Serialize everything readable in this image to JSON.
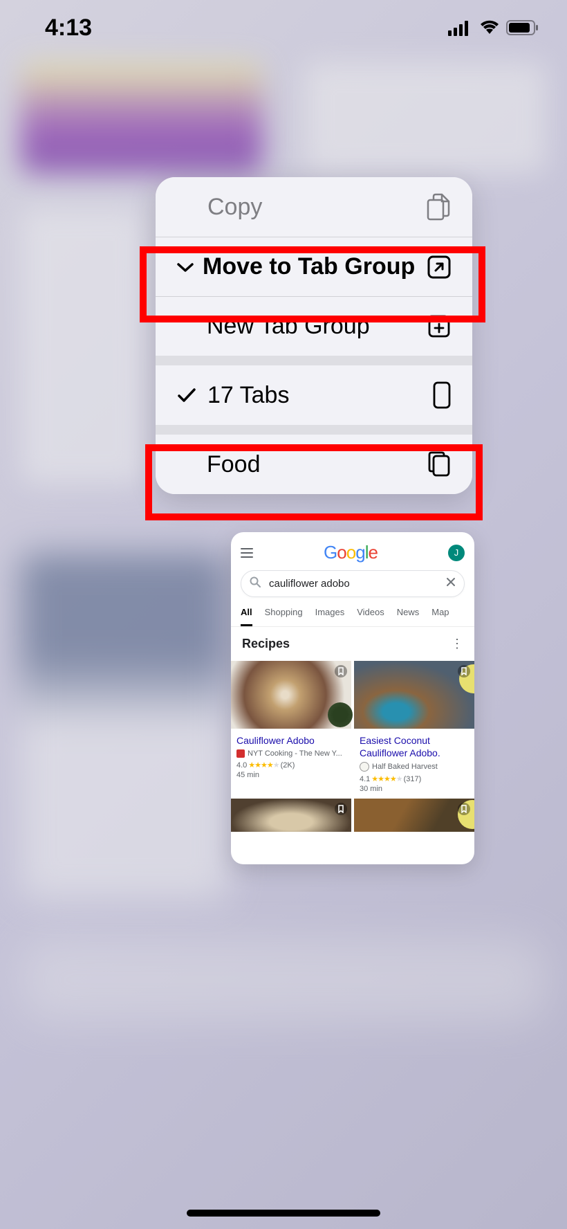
{
  "status": {
    "time": "4:13"
  },
  "menu": {
    "items": [
      {
        "label": "Copy",
        "icon": "copy-icon",
        "gray": true
      },
      {
        "label": "Move to Tab Group",
        "icon": "open-icon",
        "bold": true,
        "chevron": true
      },
      {
        "label": "New Tab Group",
        "icon": "new-tab-group-icon"
      },
      {
        "label": "17 Tabs",
        "icon": "device-icon",
        "checked": true
      },
      {
        "label": "Food",
        "icon": "copy-rect-icon"
      }
    ]
  },
  "preview": {
    "avatar_initial": "J",
    "search_value": "cauliflower adobo",
    "tabs": [
      "All",
      "Shopping",
      "Images",
      "Videos",
      "News",
      "Map"
    ],
    "active_tab": "All",
    "recipes_header": "Recipes",
    "recipes": [
      {
        "title": "Cauliflower Adobo",
        "source": "NYT Cooking - The New Y...",
        "rating": "4.0",
        "review_count": "(2K)",
        "time": "45 min"
      },
      {
        "title": "Easiest Coconut Cauliflower Adobo.",
        "source": "Half Baked Harvest",
        "rating": "4.1",
        "review_count": "(317)",
        "time": "30 min"
      }
    ]
  }
}
